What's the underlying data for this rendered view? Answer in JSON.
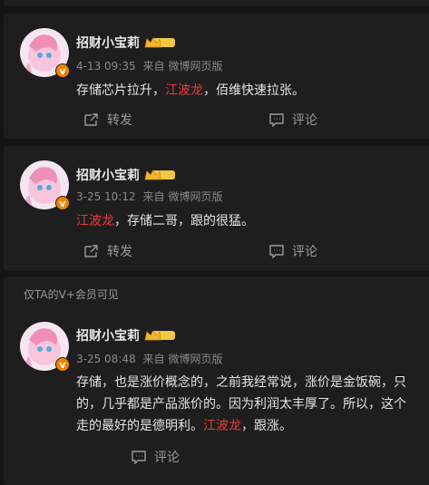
{
  "colors": {
    "accent_red": "#eb3b3b",
    "vip_orange": "#f08300",
    "background": "#141414",
    "card": "#1e1e1e"
  },
  "posts": [
    {
      "author": "招财小宝莉",
      "time": "4-13 09:35",
      "source_prefix": "来自",
      "source": "微博网页版",
      "text": {
        "before": "存储芯片拉升，",
        "highlight": "江波龙",
        "after": "，佰维快速拉张。"
      },
      "repost_label": "转发",
      "comment_label": "评论"
    },
    {
      "author": "招财小宝莉",
      "time": "3-25 10:12",
      "source_prefix": "来自",
      "source": "微博网页版",
      "text": {
        "before": "",
        "highlight": "江波龙",
        "after": "，存储二哥，跟的很猛。"
      },
      "repost_label": "转发",
      "comment_label": "评论"
    },
    {
      "vip_note": "仅TA的V+会员可见",
      "author": "招财小宝莉",
      "time": "3-25 08:48",
      "source_prefix": "来自",
      "source": "微博网页版",
      "text_lines": [
        "存储，也是涨价概念的，之前我经常说，涨价是金饭碗，只",
        "的，几乎都是产品涨价的。因为利润太丰厚了。所以，这个"
      ],
      "text_last": {
        "before": "走的最好的是德明利。",
        "highlight": "江波龙",
        "after": "，跟涨。"
      },
      "comment_label": "评论"
    }
  ],
  "icons": {
    "verified_badge": "v-badge-icon",
    "member_badge": "crown-member-icon",
    "repost": "repost-icon",
    "comment": "comment-icon"
  },
  "badge_letter": "v"
}
